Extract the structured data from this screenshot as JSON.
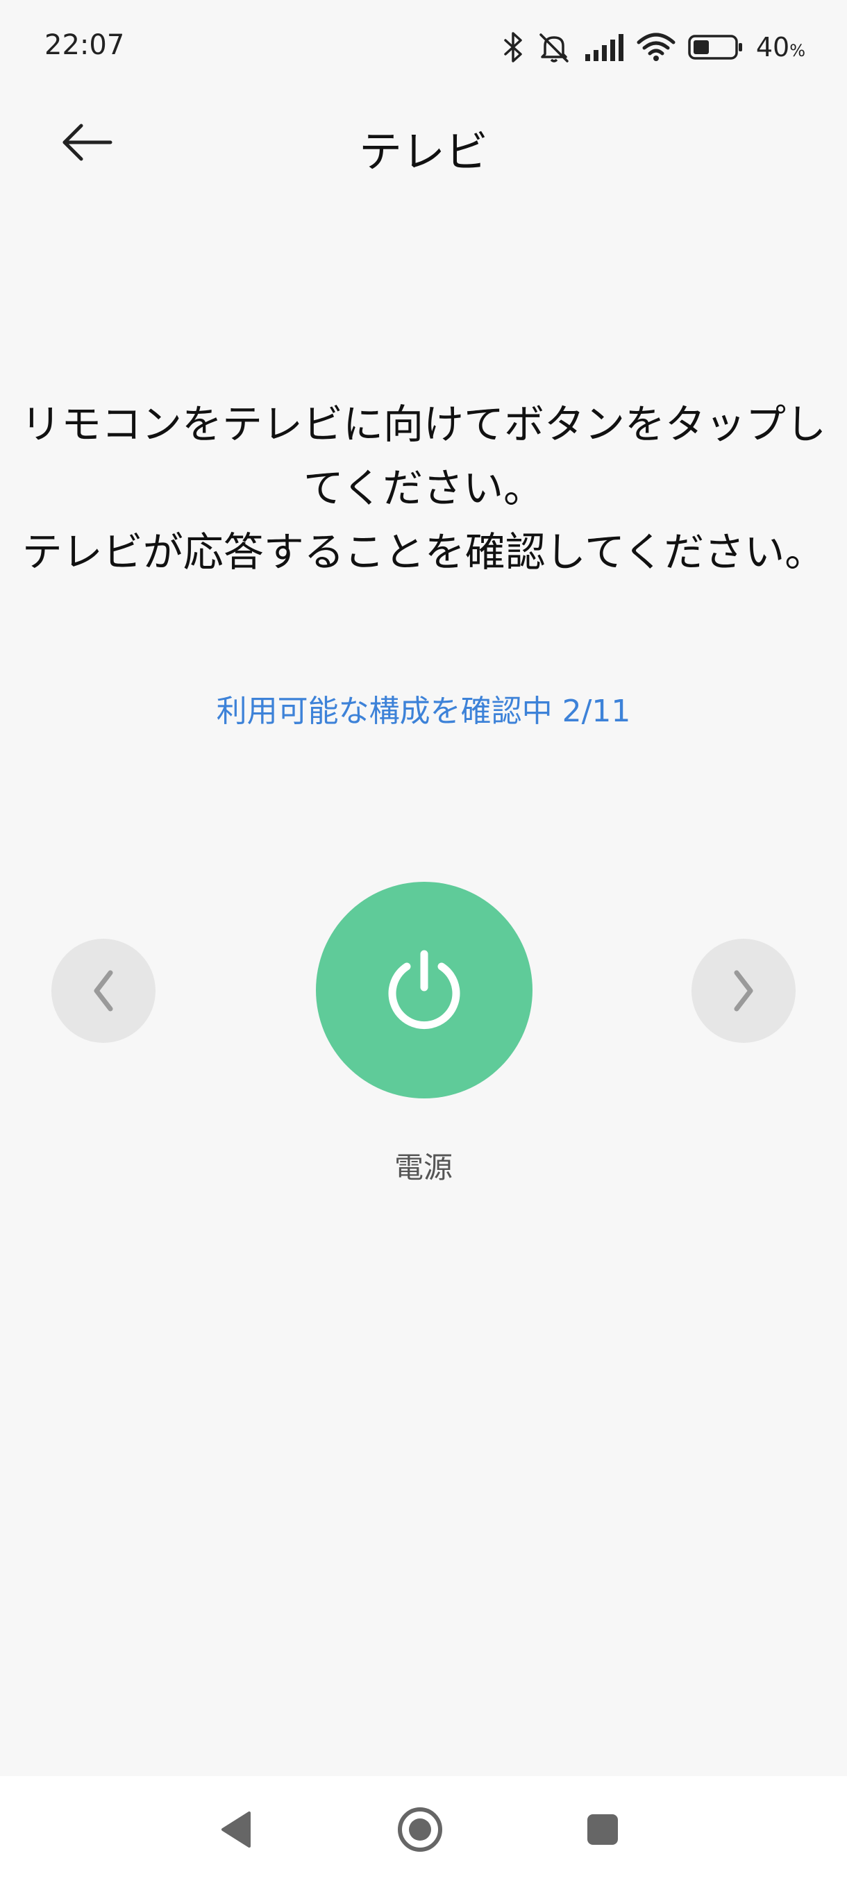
{
  "status_bar": {
    "time": "22:07",
    "battery_percent": "40",
    "battery_unit": "%",
    "battery_level": 0.4,
    "icons": [
      "bluetooth-icon",
      "silent-icon",
      "signal-icon",
      "wifi-icon",
      "battery-icon"
    ]
  },
  "header": {
    "title": "テレビ",
    "back_icon": "arrow-left-icon"
  },
  "main": {
    "instruction_line1": "リモコンをテレビに向けてボタンをタップしてください。",
    "instruction_line2": "テレビが応答することを確認してください。",
    "progress_text": "利用可能な構成を確認中 2/11",
    "power_button_label": "電源",
    "prev_icon": "chevron-left-icon",
    "next_icon": "chevron-right-icon",
    "power_icon": "power-icon"
  },
  "colors": {
    "accent_blue": "#3d82d8",
    "power_green": "#5fcb99",
    "background": "#f7f7f7",
    "nav_circle": "#e6e6e6"
  },
  "nav_bar": {
    "icons": [
      "back-triangle-icon",
      "home-circle-icon",
      "recents-square-icon"
    ]
  }
}
